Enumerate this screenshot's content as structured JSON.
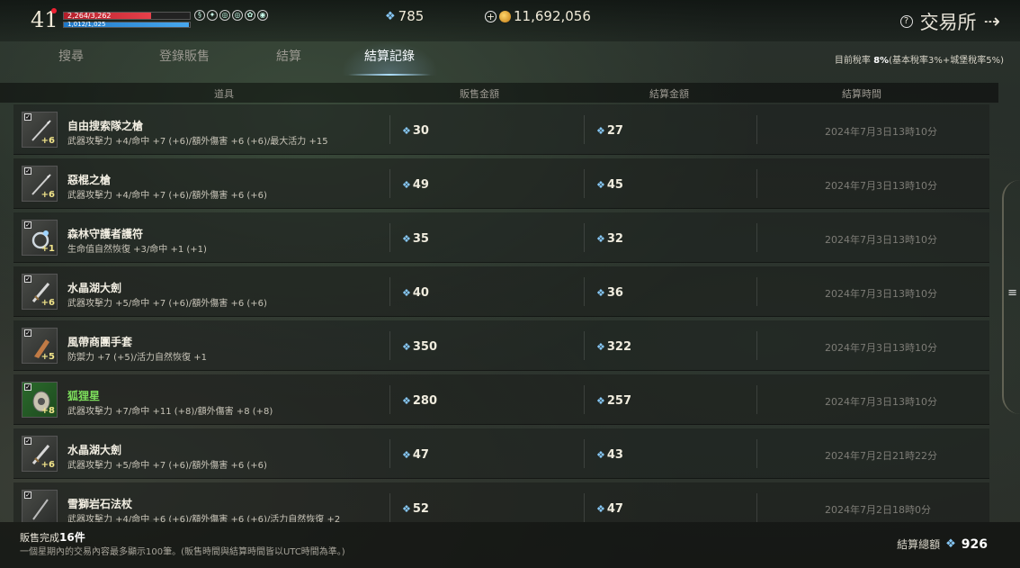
{
  "player": {
    "level": "41",
    "hp_text": "2,264/3,262",
    "hp_fraction": 0.69,
    "mp_text": "1,012/1,025",
    "mp_fraction": 0.99,
    "buff_icons": [
      "b1-icon",
      "b2-icon",
      "b3-icon",
      "b4-icon",
      "b5-icon",
      "b6-icon"
    ]
  },
  "currency": {
    "gem": "785",
    "gold": "11,692,056"
  },
  "window": {
    "title": "交易所",
    "help_glyph": "?",
    "exit_glyph": "⇢"
  },
  "tabs": [
    "搜尋",
    "登錄販售",
    "結算",
    "結算記錄"
  ],
  "active_tab": 3,
  "tax": {
    "label": "目前稅率",
    "rate": "8%",
    "detail": "(基本稅率3%+城堡稅率5%)"
  },
  "columns": [
    "道具",
    "販售金額",
    "結算金額",
    "結算時間"
  ],
  "rows": [
    {
      "name": "自由搜索隊之槍",
      "stats": "武器攻擊力 +4/命中 +7 (+6)/額外傷害 +6 (+6)/最大活力 +15",
      "enh": "+6",
      "sale": "30",
      "settle": "27",
      "time": "2024年7月3日13時10分",
      "icon": "spear-icon",
      "rare": false
    },
    {
      "name": "惡棍之槍",
      "stats": "武器攻擊力 +4/命中 +7 (+6)/額外傷害 +6 (+6)",
      "enh": "+6",
      "sale": "49",
      "settle": "45",
      "time": "2024年7月3日13時10分",
      "icon": "spear-icon",
      "rare": false
    },
    {
      "name": "森林守護者護符",
      "stats": "生命值自然恢復 +3/命中 +1 (+1)",
      "enh": "+1",
      "sale": "35",
      "settle": "32",
      "time": "2024年7月3日13時10分",
      "icon": "ring-icon",
      "rare": false
    },
    {
      "name": "水晶湖大劍",
      "stats": "武器攻擊力 +5/命中 +7 (+6)/額外傷害 +6 (+6)",
      "enh": "+6",
      "sale": "40",
      "settle": "36",
      "time": "2024年7月3日13時10分",
      "icon": "sword-icon",
      "rare": false
    },
    {
      "name": "風帶商團手套",
      "stats": "防禦力 +7 (+5)/活力自然恢復 +1",
      "enh": "+5",
      "sale": "350",
      "settle": "322",
      "time": "2024年7月3日13時10分",
      "icon": "glove-icon",
      "rare": false
    },
    {
      "name": "狐狸星",
      "stats": "武器攻擊力 +7/命中 +11 (+8)/額外傷害 +8 (+8)",
      "enh": "+8",
      "sale": "280",
      "settle": "257",
      "time": "2024年7月3日13時10分",
      "icon": "shield-icon",
      "rare": true
    },
    {
      "name": "水晶湖大劍",
      "stats": "武器攻擊力 +5/命中 +7 (+6)/額外傷害 +6 (+6)",
      "enh": "+6",
      "sale": "47",
      "settle": "43",
      "time": "2024年7月2日21時22分",
      "icon": "sword-icon",
      "rare": false
    },
    {
      "name": "雪獅岩石法杖",
      "stats": "武器攻擊力 +4/命中 +6 (+6)/額外傷害 +6 (+6)/活力自然恢復 +2",
      "enh": "",
      "sale": "52",
      "settle": "47",
      "time": "2024年7月2日18時0分",
      "icon": "staff-icon",
      "rare": false
    }
  ],
  "footer": {
    "sold_label": "販售完成",
    "sold_count": "16件",
    "note": "一個星期內的交易內容最多顯示100筆。(販售時間與結算時間皆以UTC時間為準。)",
    "total_label": "結算總額",
    "total_value": "926"
  },
  "side_handle": "≡"
}
